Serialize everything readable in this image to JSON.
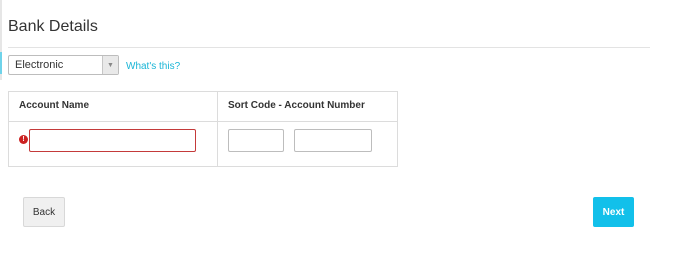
{
  "section": {
    "title": "Bank Details"
  },
  "payment_method": {
    "selected": "Electronic",
    "help_link": "What's this?"
  },
  "table": {
    "headers": {
      "account_name": "Account Name",
      "sort_code_account_number": "Sort Code - Account Number"
    },
    "fields": {
      "account_name": {
        "value": "",
        "state": "error"
      },
      "sort_code": {
        "value": ""
      },
      "account_number": {
        "value": ""
      }
    },
    "error_icon_glyph": "!"
  },
  "actions": {
    "back_label": "Back",
    "next_label": "Next"
  },
  "colors": {
    "accent": "#12c0ea",
    "link": "#19b5d6",
    "error": "#cc2222"
  },
  "icons": {
    "dropdown": "chevron-down-icon",
    "error": "error-icon"
  }
}
